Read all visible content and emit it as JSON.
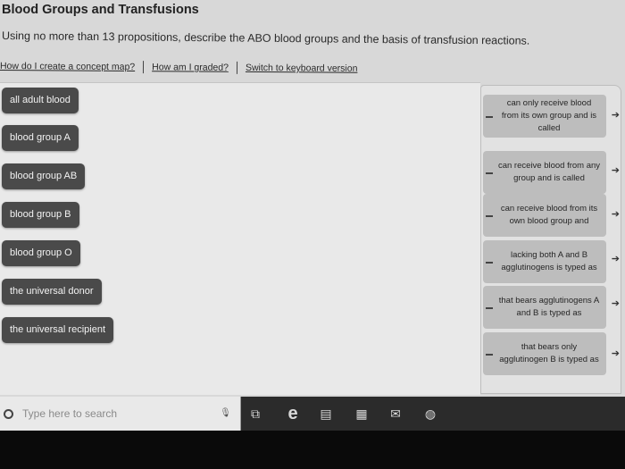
{
  "header": {
    "title": "Blood Groups and Transfusions",
    "instruction": "Using no more than 13 propositions, describe the ABO blood groups and the basis of transfusion reactions."
  },
  "links": {
    "concept_map": "How do I create a concept map?",
    "graded": "How am I graded?",
    "keyboard": "Switch to keyboard version"
  },
  "concepts": [
    "all adult blood",
    "blood group A",
    "blood group AB",
    "blood group B",
    "blood group O",
    "the universal donor",
    "the universal recipient"
  ],
  "phrases": [
    "can only receive blood from its own group and is called",
    "can receive blood from any group and is called",
    "can receive blood from its own blood group and",
    "lacking both A and B agglutinogens is typed as",
    "that bears agglutinogens A and B is typed as",
    "that bears only agglutinogen B is typed as"
  ],
  "taskbar": {
    "search_placeholder": "Type here to search",
    "icons": [
      "microphone-icon",
      "task-view-icon",
      "edge-icon",
      "file-explorer-icon",
      "store-icon",
      "mail-icon",
      "chrome-icon"
    ]
  },
  "colors": {
    "chip_bg": "#4a4a4a",
    "phrase_bg": "#bdbdbd",
    "taskbar_bg": "#2b2b2b"
  }
}
